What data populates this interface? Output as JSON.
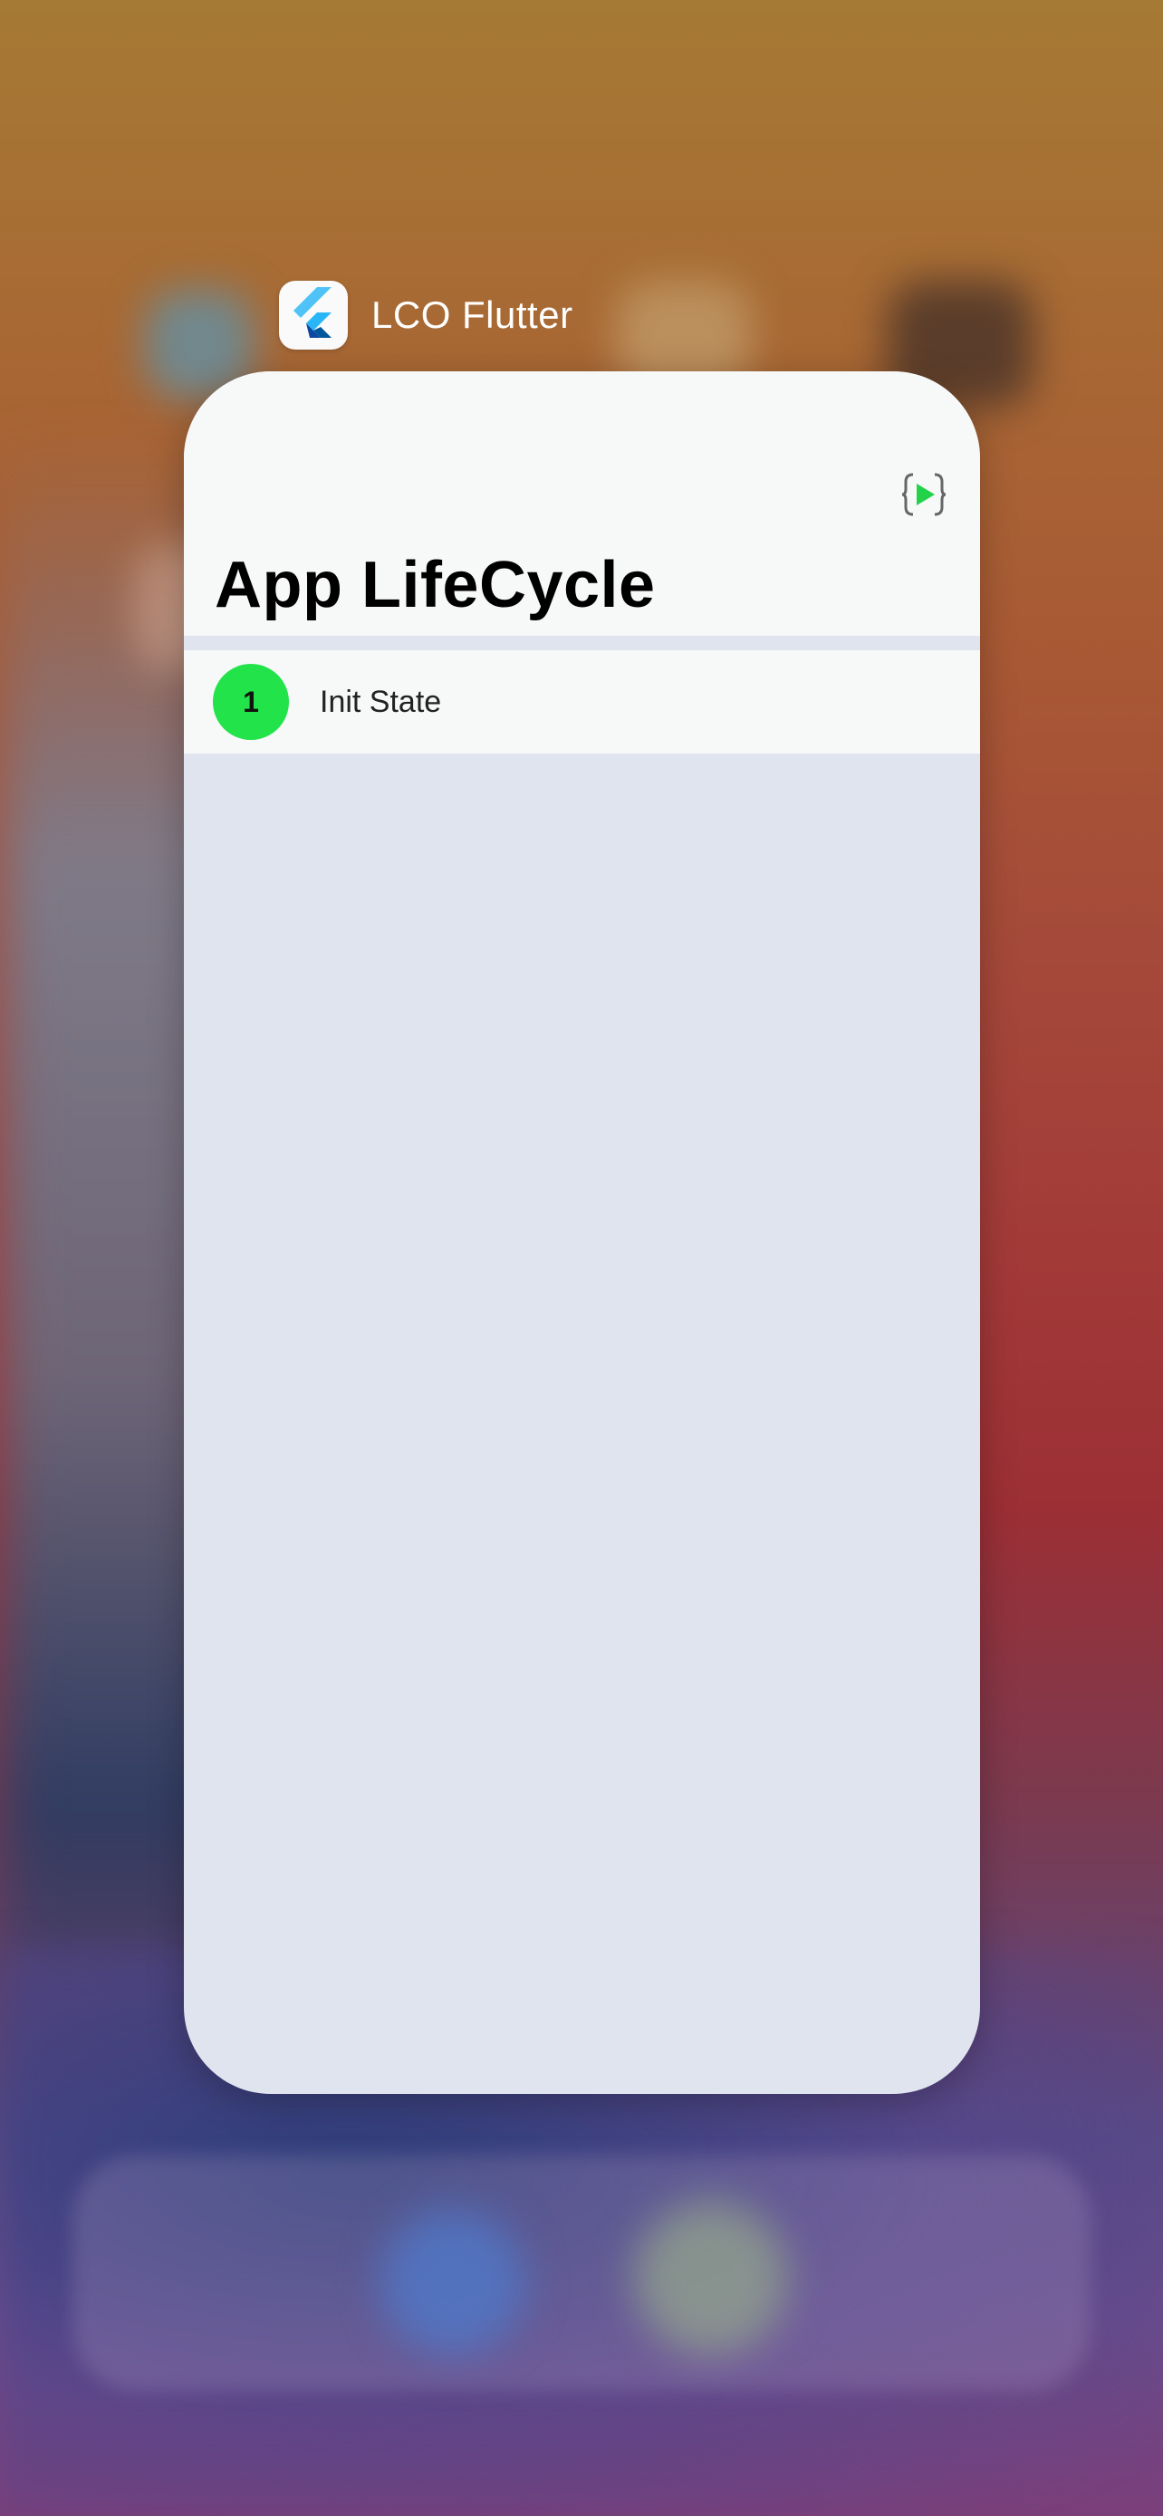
{
  "app_switcher": {
    "app_name": "LCO Flutter",
    "app_icon": "flutter-logo-icon"
  },
  "screen": {
    "title": "App LifeCycle",
    "debug_icon": "braces-play-icon",
    "items": [
      {
        "count": "1",
        "label": "Init State",
        "color": "#22e34a"
      }
    ]
  },
  "colors": {
    "accent_green": "#22e34a",
    "card_bg": "#e0e4ef",
    "bar_bg": "#f7f8f8"
  }
}
